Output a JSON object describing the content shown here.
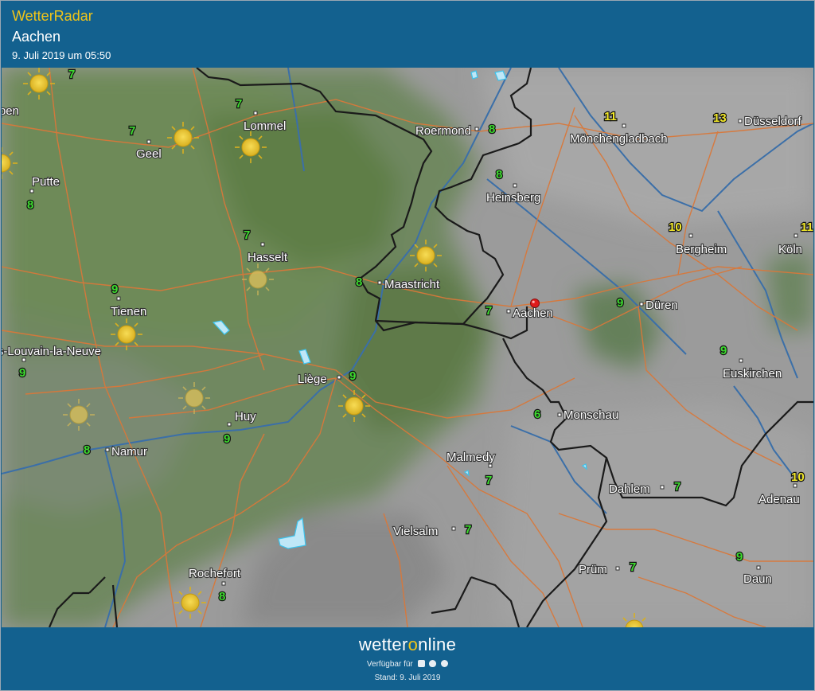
{
  "header": {
    "brand": "WetterRadar",
    "location": "Aachen",
    "timestamp": "9. Juli 2019 um 05:50"
  },
  "footer": {
    "logo_pre": "wetter",
    "logo_o": "o",
    "logo_post": "nline",
    "available_label": "Verfügbar für",
    "platform_icons": [
      "android-icon",
      "apple-icon",
      "web-icon"
    ],
    "stand": "Stand: 9. Juli 2019"
  },
  "colors": {
    "header_bg": "#13618f",
    "brand_yellow": "#f0c419",
    "temp_green": "#3ddc2f",
    "temp_yellow": "#f2e829",
    "border_black": "#1a1a1a",
    "road_orange": "#d9783a",
    "river_blue": "#3b6fa8",
    "marker_red": "#e01b1b"
  },
  "cities": [
    {
      "name": "Roermond",
      "temp": "8"
    },
    {
      "name": "Mönchengladbach",
      "temp": "11"
    },
    {
      "name": "Düsseldorf",
      "temp": "13"
    },
    {
      "name": "Lommel",
      "temp": "7"
    },
    {
      "name": "Geel",
      "temp": "7"
    },
    {
      "name": "Putte",
      "temp": "8"
    },
    {
      "name": "Heinsberg",
      "temp": "8"
    },
    {
      "name": "Hasselt",
      "temp": "7"
    },
    {
      "name": "Bergheim",
      "temp": "10"
    },
    {
      "name": "Köln",
      "temp": "11"
    },
    {
      "name": "Maastricht",
      "temp": "8"
    },
    {
      "name": "Tienen",
      "temp": "9"
    },
    {
      "name": "Aachen",
      "temp": "7"
    },
    {
      "name": "Düren",
      "temp": "9"
    },
    {
      "name": "Ottignies-Louvain-la-Neuve",
      "temp": "9"
    },
    {
      "name": "Euskirchen",
      "temp": "9"
    },
    {
      "name": "Liège",
      "temp": "9"
    },
    {
      "name": "Huy",
      "temp": "9"
    },
    {
      "name": "Monschau",
      "temp": "6"
    },
    {
      "name": "Namur",
      "temp": "8"
    },
    {
      "name": "Malmedy",
      "temp": "7"
    },
    {
      "name": "Dahlem",
      "temp": "7"
    },
    {
      "name": "Adenau",
      "temp": "10"
    },
    {
      "name": "Vielsalm",
      "temp": "7"
    },
    {
      "name": "Prüm",
      "temp": "7"
    },
    {
      "name": "Daun",
      "temp": "9"
    },
    {
      "name": "Rochefort",
      "temp": "8"
    },
    {
      "name": "Antwerpen",
      "temp": "7"
    }
  ],
  "weather_icons": [
    "sun-icon",
    "sun-icon",
    "sun-icon",
    "sun-icon",
    "sun-icon",
    "sun-icon",
    "sun-icon",
    "sun-icon",
    "sun-icon",
    "sun-icon",
    "sun-icon",
    "sun-icon"
  ]
}
